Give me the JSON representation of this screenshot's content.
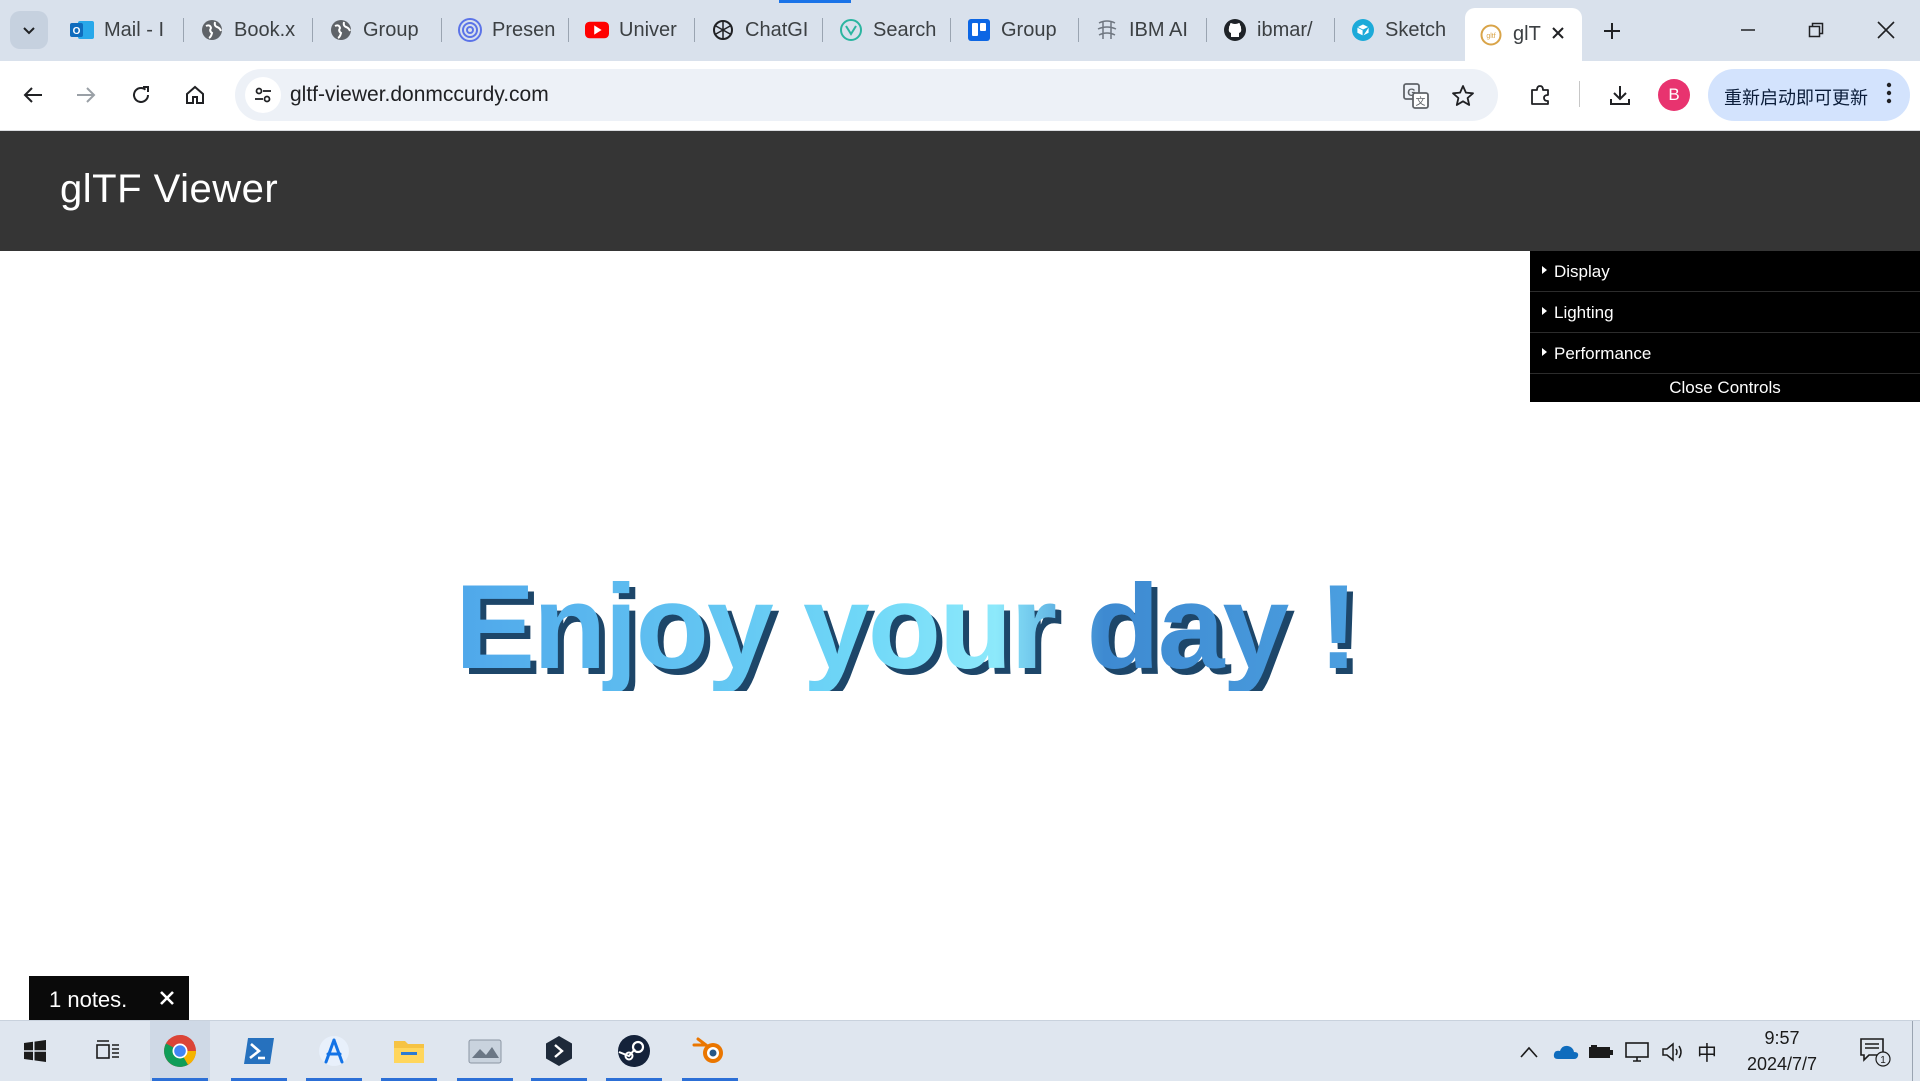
{
  "browser": {
    "tabs": [
      {
        "title": "Mail - I",
        "icon": "outlook-icon"
      },
      {
        "title": "Book.x",
        "icon": "globe-icon"
      },
      {
        "title": "Group",
        "icon": "globe-icon"
      },
      {
        "title": "Presen",
        "icon": "target-icon"
      },
      {
        "title": "Univer",
        "icon": "youtube-icon"
      },
      {
        "title": "ChatGI",
        "icon": "openai-icon"
      },
      {
        "title": "Search",
        "icon": "search-site-icon"
      },
      {
        "title": "Group",
        "icon": "trello-icon"
      },
      {
        "title": "IBM AI",
        "icon": "ibm-icon"
      },
      {
        "title": "ibmar/",
        "icon": "github-icon"
      },
      {
        "title": "Sketch",
        "icon": "sketchfab-icon"
      },
      {
        "title": "glT",
        "icon": "gltf-icon",
        "active": true
      }
    ],
    "url": "gltf-viewer.donmccurdy.com",
    "avatar_letter": "B",
    "update_label": "重新启动即可更新"
  },
  "page": {
    "title": "glTF Viewer",
    "scene_text": "Enjoy your day !",
    "controls": {
      "items": [
        "Display",
        "Lighting",
        "Performance"
      ],
      "close_label": "Close Controls"
    },
    "notes": {
      "label": "1 notes.",
      "close_glyph": "✕"
    }
  },
  "taskbar": {
    "apps": [
      "windows-start-icon",
      "task-view-icon",
      "chrome-icon",
      "powershell-icon",
      "appstore-icon",
      "file-explorer-icon",
      "photos-icon",
      "terminal-icon",
      "steam-icon",
      "blender-icon"
    ],
    "ime": "中",
    "time": "9:57",
    "date": "2024/7/7",
    "notification_count": "1"
  },
  "colors": {
    "header_bg": "#353535",
    "controls_bg": "#000000",
    "text_light_blue": "#56b4ef",
    "text_cyan": "#7fe3f9",
    "text_dark_blue": "#1f4d7a"
  }
}
